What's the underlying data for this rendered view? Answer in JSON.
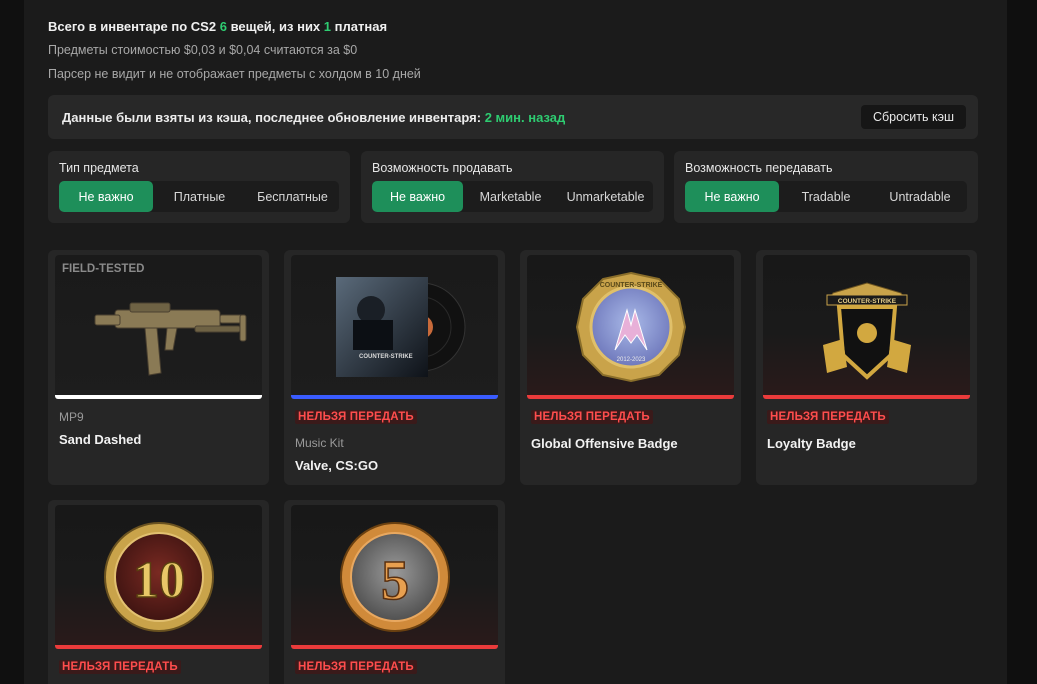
{
  "summary": {
    "prefix": "Всего в инвентаре по CS2",
    "total_count": "6",
    "middle": "вещей, из них",
    "paid_count": "1",
    "suffix": "платная",
    "note_price": "Предметы стоимостью $0,03 и $0,04 считаются за $0",
    "note_hold": "Парсер не видит и не отображает предметы с холдом в 10 дней"
  },
  "cache": {
    "text": "Данные были взяты из кэша, последнее обновление инвентаря:",
    "ago": "2 мин. назад",
    "reset_label": "Сбросить кэш"
  },
  "filters": [
    {
      "title": "Тип предмета",
      "options": [
        "Не важно",
        "Платные",
        "Бесплатные"
      ],
      "selected": "Не важно"
    },
    {
      "title": "Возможность продавать",
      "options": [
        "Не важно",
        "Marketable",
        "Unmarketable"
      ],
      "selected": "Не важно"
    },
    {
      "title": "Возможность передавать",
      "options": [
        "Не важно",
        "Tradable",
        "Untradable"
      ],
      "selected": "Не важно"
    }
  ],
  "items": [
    {
      "wear": "FIELD-TESTED",
      "type": "MP9",
      "name": "Sand Dashed",
      "warning": "",
      "rarity_color": "#ffffff",
      "icon": "mp9-smg-icon"
    },
    {
      "wear": "",
      "type": "Music Kit",
      "name": "Valve, CS:GO",
      "warning": "НЕЛЬЗЯ ПЕРЕДАТЬ",
      "rarity_color": "#3a5cff",
      "icon": "music-kit-icon"
    },
    {
      "wear": "",
      "type": "",
      "name": "Global Offensive Badge",
      "warning": "НЕЛЬЗЯ ПЕРЕДАТЬ",
      "rarity_color": "#eb3b3b",
      "icon": "global-offensive-badge-icon",
      "badge_text": "COUNTER-STRIKE",
      "badge_years": "2012-2023"
    },
    {
      "wear": "",
      "type": "",
      "name": "Loyalty Badge",
      "warning": "НЕЛЬЗЯ ПЕРЕДАТЬ",
      "rarity_color": "#eb3b3b",
      "icon": "loyalty-badge-icon",
      "badge_text": "COUNTER-STRIKE"
    },
    {
      "wear": "",
      "type": "",
      "name": "",
      "warning": "НЕЛЬЗЯ ПЕРЕДАТЬ",
      "rarity_color": "#eb3b3b",
      "icon": "ten-year-coin-icon",
      "coin_number": "10"
    },
    {
      "wear": "",
      "type": "",
      "name": "",
      "warning": "НЕЛЬЗЯ ПЕРЕДАТЬ",
      "rarity_color": "#eb3b3b",
      "icon": "five-year-coin-icon",
      "coin_number": "5"
    }
  ],
  "colors": {
    "accent_green": "#1e8f5a",
    "highlight_green": "#2ecc71",
    "warning_red": "#ff4d4d"
  }
}
